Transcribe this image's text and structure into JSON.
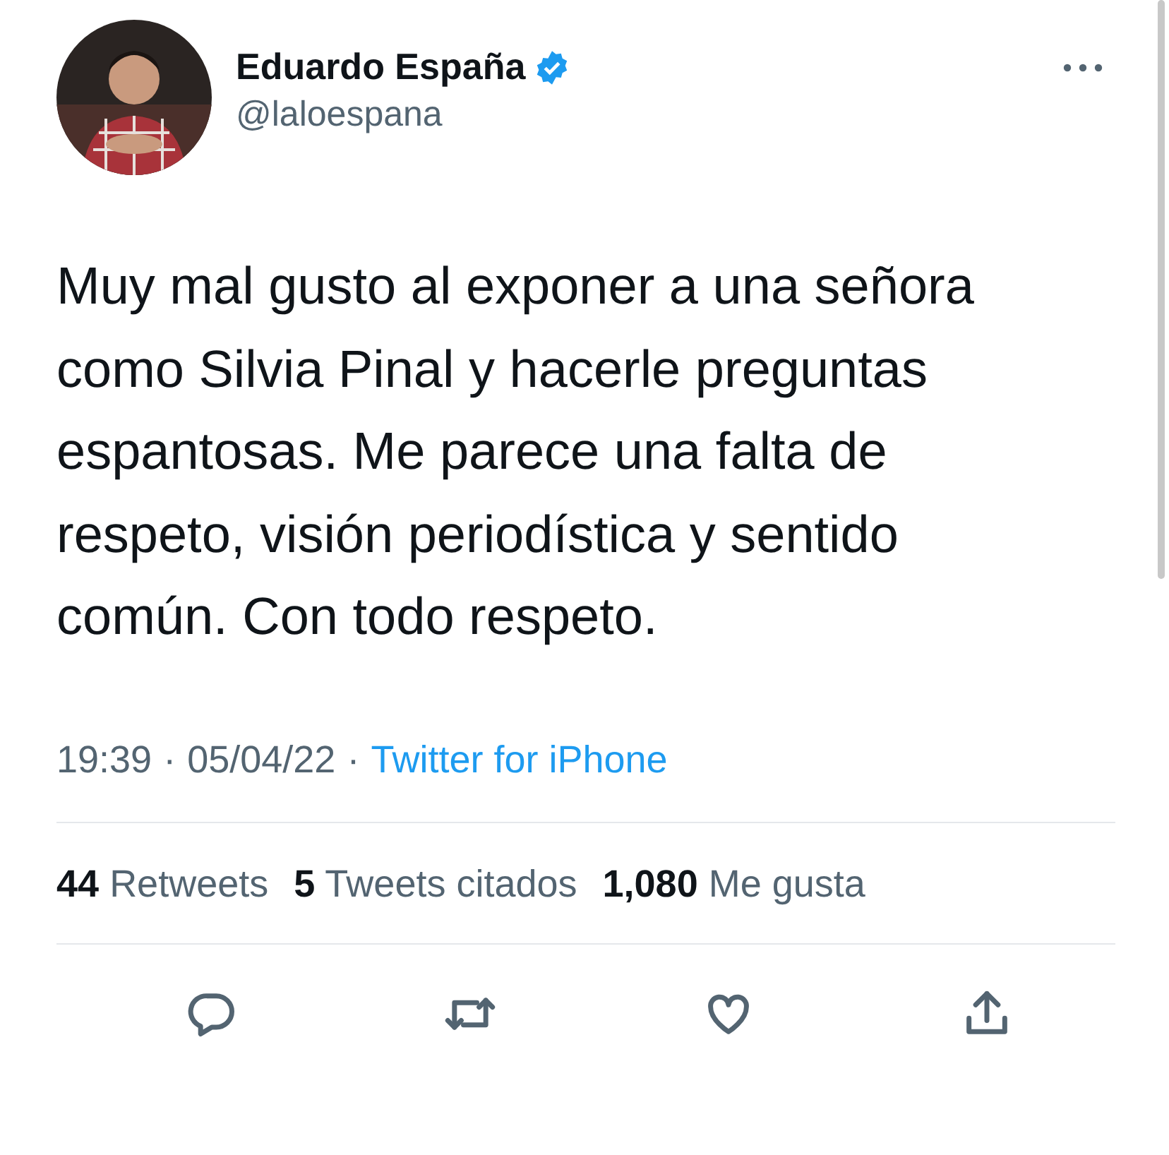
{
  "author": {
    "name": "Eduardo España",
    "verified": true,
    "handle": "@laloespana"
  },
  "tweet": {
    "text": "Muy mal gusto al exponer a una señora como Silvia Pinal y hacerle preguntas espantosas. Me parece una falta de respeto, visión periodística y sentido común. Con todo respeto."
  },
  "meta": {
    "time": "19:39",
    "separator_1": "·",
    "date": "05/04/22",
    "separator_2": "·",
    "source": "Twitter for iPhone"
  },
  "stats": [
    {
      "count": "44",
      "label": "Retweets"
    },
    {
      "count": "5",
      "label": "Tweets citados"
    },
    {
      "count": "1,080",
      "label": "Me gusta"
    }
  ],
  "actions": [
    {
      "kind": "reply"
    },
    {
      "kind": "retweet"
    },
    {
      "kind": "like"
    },
    {
      "kind": "share"
    }
  ]
}
